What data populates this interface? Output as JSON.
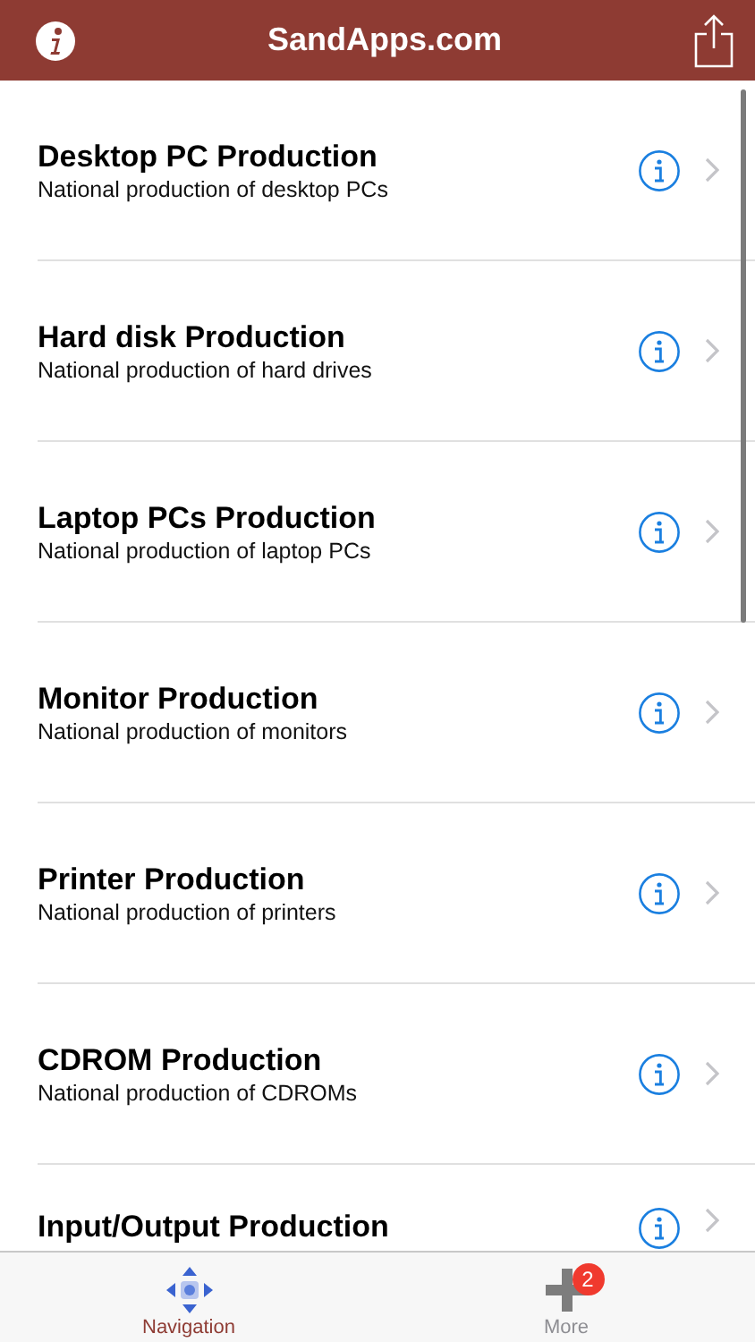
{
  "nav_bar": {
    "title": "SandApps.com"
  },
  "rows": [
    {
      "title": "Desktop PC Production",
      "subtitle": "National production of desktop PCs"
    },
    {
      "title": "Hard disk Production",
      "subtitle": "National production of hard drives"
    },
    {
      "title": "Laptop PCs Production",
      "subtitle": "National production of laptop PCs"
    },
    {
      "title": "Monitor Production",
      "subtitle": "National production of monitors"
    },
    {
      "title": "Printer Production",
      "subtitle": "National production of printers"
    },
    {
      "title": "CDROM Production",
      "subtitle": "National production of CDROMs"
    },
    {
      "title": "Input/Output Production"
    }
  ],
  "tab_bar": [
    {
      "kind": "navigation",
      "label": "Navigation",
      "selected": true
    },
    {
      "kind": "more",
      "label": "More",
      "selected": false,
      "badge": "2"
    }
  ]
}
